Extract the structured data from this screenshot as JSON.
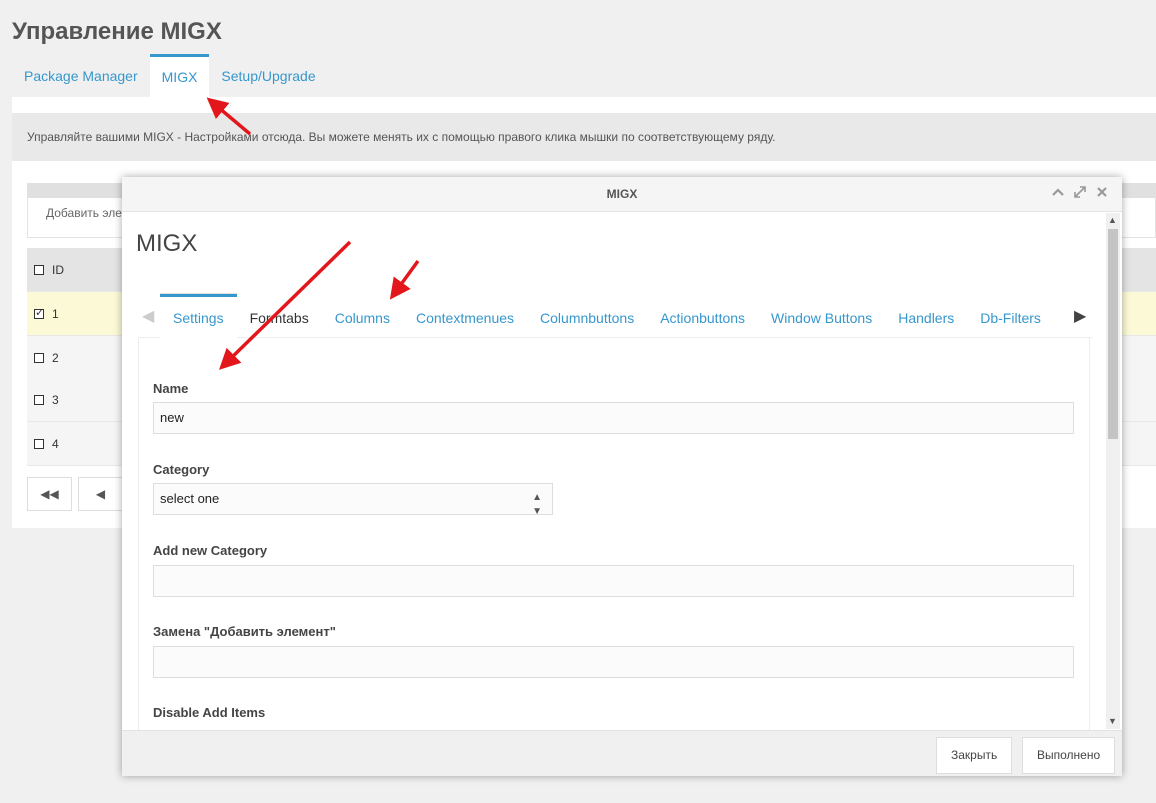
{
  "page": {
    "title": "Управление MIGX"
  },
  "page_tabs": [
    {
      "label": "Package Manager"
    },
    {
      "label": "MIGX"
    },
    {
      "label": "Setup/Upgrade"
    }
  ],
  "description": "Управляйте вашими MIGX - Настройками отсюда. Вы можете менять их с помощью правого клика мышки по соответствующему ряду.",
  "grid": {
    "add_button": "Добавить элемент",
    "id_header": "ID",
    "rows": [
      {
        "id": "1",
        "checked": true
      },
      {
        "id": "2",
        "checked": false
      },
      {
        "id": "3",
        "checked": false
      },
      {
        "id": "4",
        "checked": false
      }
    ]
  },
  "window": {
    "title": "MIGX",
    "heading": "MIGX",
    "tabs": [
      {
        "label": "Settings"
      },
      {
        "label": "Formtabs"
      },
      {
        "label": "Columns"
      },
      {
        "label": "Contextmenues"
      },
      {
        "label": "Columnbuttons"
      },
      {
        "label": "Actionbuttons"
      },
      {
        "label": "Window Buttons"
      },
      {
        "label": "Handlers"
      },
      {
        "label": "Db-Filters"
      }
    ],
    "fields": {
      "name_label": "Name",
      "name_value": "new",
      "category_label": "Category",
      "category_value": "select one",
      "new_category_label": "Add new Category",
      "add_item_label": "Замена \"Добавить элемент\"",
      "disable_add_label": "Disable Add Items"
    },
    "buttons": {
      "close": "Закрыть",
      "done": "Выполнено"
    }
  },
  "colors": {
    "accent": "#3697cd",
    "arrow": "#e3171b",
    "selected_row": "#fcfad6"
  },
  "icons": [
    "collapse-icon",
    "maximize-icon",
    "close-icon",
    "first-page-icon",
    "prev-page-icon",
    "tab-scroll-left-icon",
    "tab-scroll-right-icon",
    "select-arrows-icon"
  ]
}
